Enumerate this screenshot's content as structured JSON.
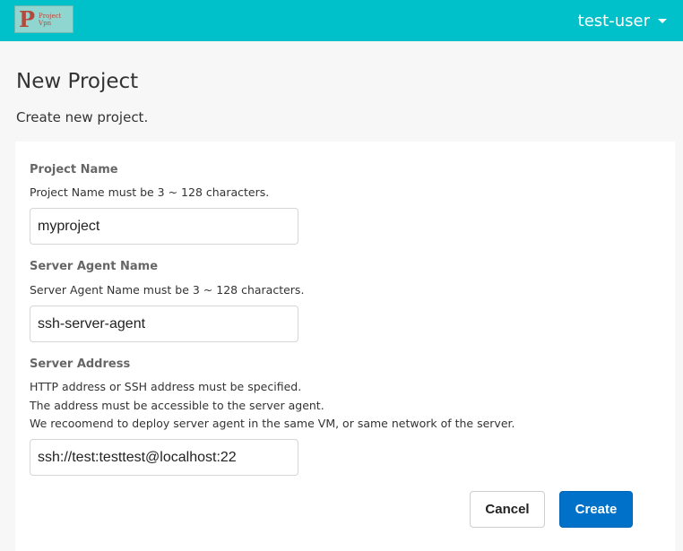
{
  "header": {
    "logo_letter": "P",
    "logo_line1": "Project",
    "logo_line2": "Vpn",
    "user_name": "test-user",
    "caret_icon": "chevron-down-icon"
  },
  "page": {
    "title": "New Project",
    "subtitle": "Create new project."
  },
  "form": {
    "project_name": {
      "label": "Project Name",
      "help": "Project Name must be 3 ~ 128 characters.",
      "value": "myproject"
    },
    "server_agent_name": {
      "label": "Server Agent Name",
      "help": "Server Agent Name must be 3 ~ 128 characters.",
      "value": "ssh-server-agent"
    },
    "server_address": {
      "label": "Server Address",
      "help_lines": [
        "HTTP address or SSH address must be specified.",
        "The address must be accessible to the server agent.",
        "We recoomend to deploy server agent in the same VM, or same network of the server."
      ],
      "value": "ssh://test:testtest@localhost:22"
    },
    "cancel_label": "Cancel",
    "create_label": "Create"
  },
  "colors": {
    "header_bg": "#00c1c9",
    "primary_button": "#0071c9",
    "page_bg": "#f7f7f7"
  }
}
